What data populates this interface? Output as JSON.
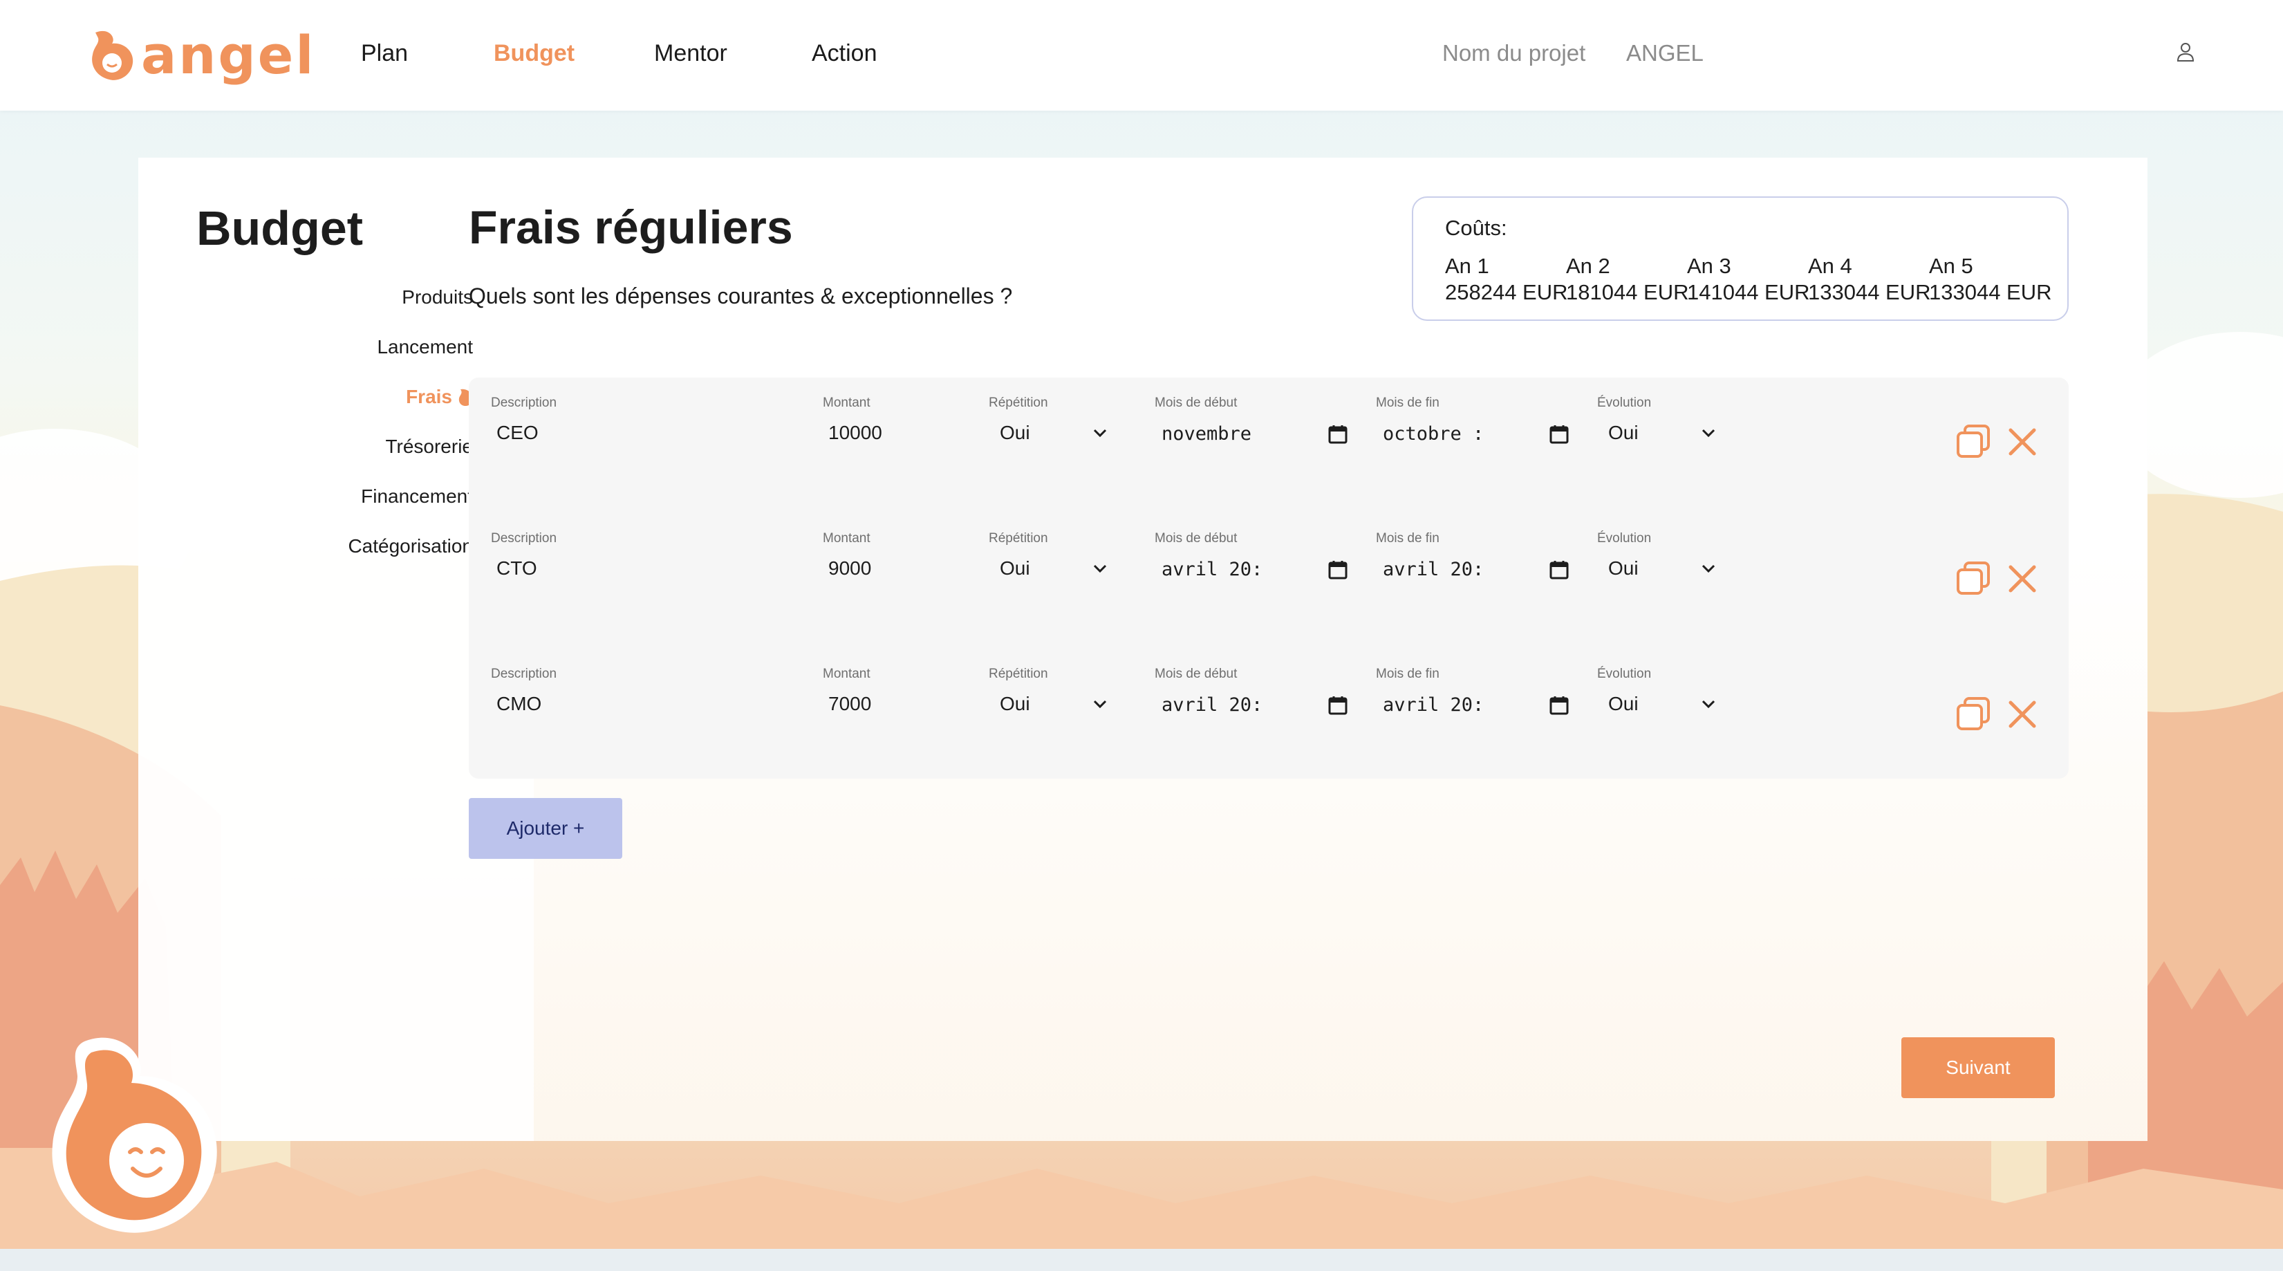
{
  "header": {
    "logo_text": "angel",
    "nav": [
      {
        "label": "Plan",
        "active": false
      },
      {
        "label": "Budget",
        "active": true
      },
      {
        "label": "Mentor",
        "active": false
      },
      {
        "label": "Action",
        "active": false
      }
    ],
    "project_label": "Nom du projet",
    "project_name": "ANGEL",
    "user_icon": "user-icon"
  },
  "sidebar": {
    "title": "Budget",
    "items": [
      {
        "label": "Produits",
        "active": false
      },
      {
        "label": "Lancement",
        "active": false
      },
      {
        "label": "Frais",
        "active": true,
        "icon": "drop-icon"
      },
      {
        "label": "Trésorerie",
        "active": false
      },
      {
        "label": "Financement",
        "active": false
      },
      {
        "label": "Catégorisation",
        "active": false
      }
    ]
  },
  "main": {
    "title": "Frais réguliers",
    "subtitle": "Quels sont les dépenses courantes & exceptionnelles ?",
    "costs": {
      "title": "Coûts:",
      "years": [
        {
          "label": "An 1",
          "value": "258244 EUR"
        },
        {
          "label": "An 2",
          "value": "181044 EUR"
        },
        {
          "label": "An 3",
          "value": "141044 EUR"
        },
        {
          "label": "An 4",
          "value": "133044 EUR"
        },
        {
          "label": "An 5",
          "value": "133044 EUR"
        }
      ]
    },
    "field_labels": {
      "description": "Description",
      "amount": "Montant",
      "repetition": "Répétition",
      "start": "Mois de début",
      "end": "Mois de fin",
      "evolution": "Évolution"
    },
    "rows": [
      {
        "description": "CEO",
        "amount": "10000",
        "repetition": "Oui",
        "start": "novembre",
        "end": "octobre :",
        "evolution": "Oui"
      },
      {
        "description": "CTO",
        "amount": "9000",
        "repetition": "Oui",
        "start": "avril 20:",
        "end": "avril 20:",
        "evolution": "Oui"
      },
      {
        "description": "CMO",
        "amount": "7000",
        "repetition": "Oui",
        "start": "avril 20:",
        "end": "avril 20:",
        "evolution": "Oui"
      }
    ],
    "add_label": "Ajouter +",
    "next_label": "Suivant"
  },
  "colors": {
    "accent": "#f0935c",
    "add_button": "#bcc3ec",
    "cost_border": "#c9ceea"
  }
}
